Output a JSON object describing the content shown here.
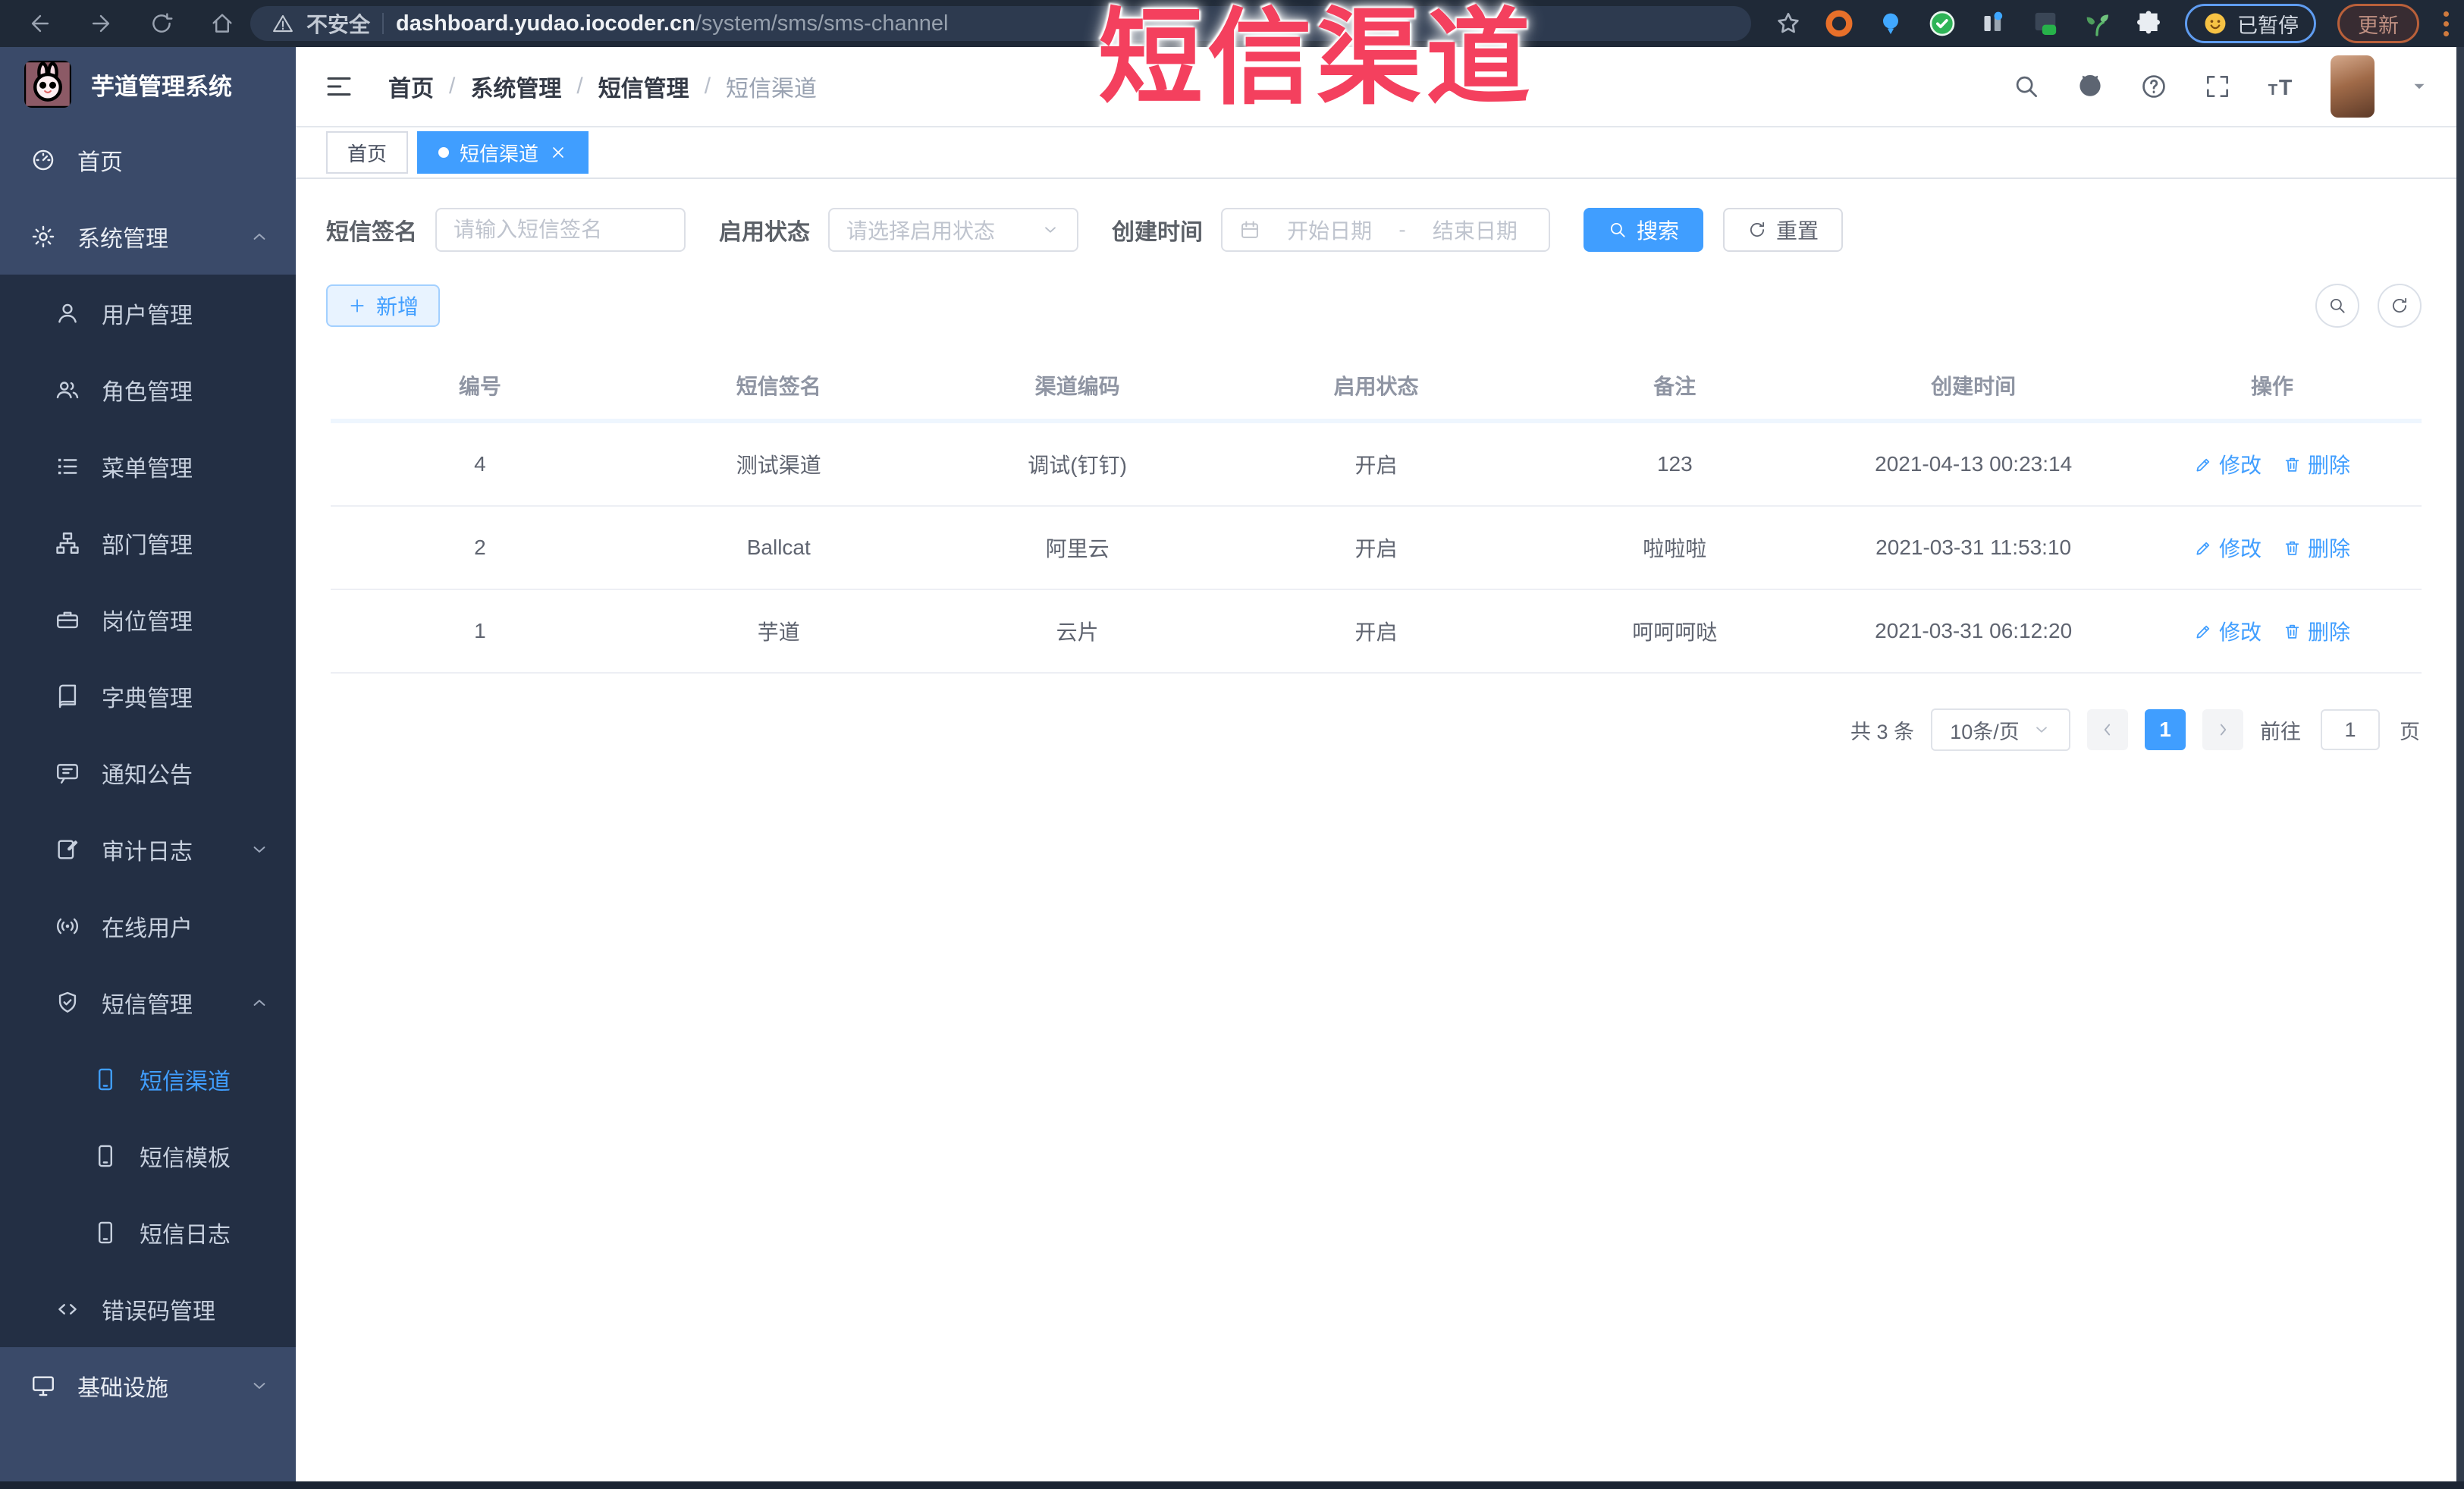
{
  "browser": {
    "security_label": "不安全",
    "url_domain": "dashboard.yudao.iocoder.cn",
    "url_path": "/system/sms/sms-channel",
    "paused_label": "已暂停",
    "update_label": "更新"
  },
  "overlay": {
    "title": "短信渠道",
    "color": "#f4405e"
  },
  "sidebar": {
    "logo_title": "芋道管理系统",
    "menu": [
      {
        "label": "首页",
        "icon": "dashboard",
        "level": 0,
        "variant": "top"
      },
      {
        "label": "系统管理",
        "icon": "gear",
        "level": 0,
        "variant": "top",
        "chevron": "up"
      },
      {
        "label": "用户管理",
        "icon": "user",
        "level": 1
      },
      {
        "label": "角色管理",
        "icon": "users",
        "level": 1
      },
      {
        "label": "菜单管理",
        "icon": "list",
        "level": 1
      },
      {
        "label": "部门管理",
        "icon": "tree",
        "level": 1
      },
      {
        "label": "岗位管理",
        "icon": "suitcase",
        "level": 1
      },
      {
        "label": "字典管理",
        "icon": "book",
        "level": 1
      },
      {
        "label": "通知公告",
        "icon": "message",
        "level": 1
      },
      {
        "label": "审计日志",
        "icon": "log",
        "level": 1,
        "chevron": "down"
      },
      {
        "label": "在线用户",
        "icon": "online",
        "level": 1
      },
      {
        "label": "短信管理",
        "icon": "sms",
        "level": 1,
        "chevron": "up"
      },
      {
        "label": "短信渠道",
        "icon": "phone",
        "level": 2,
        "active": true
      },
      {
        "label": "短信模板",
        "icon": "phone",
        "level": 2
      },
      {
        "label": "短信日志",
        "icon": "phone",
        "level": 2
      },
      {
        "label": "错误码管理",
        "icon": "code",
        "level": 1
      },
      {
        "label": "基础设施",
        "icon": "monitor",
        "level": 0,
        "variant": "top",
        "chevron": "down"
      }
    ]
  },
  "header": {
    "breadcrumbs": [
      {
        "label": "首页"
      },
      {
        "label": "系统管理"
      },
      {
        "label": "短信管理"
      },
      {
        "label": "短信渠道",
        "current": true
      }
    ]
  },
  "tabs": [
    {
      "label": "首页"
    },
    {
      "label": "短信渠道",
      "active": true
    }
  ],
  "filters": {
    "signature_label": "短信签名",
    "signature_placeholder": "请输入短信签名",
    "status_label": "启用状态",
    "status_placeholder": "请选择启用状态",
    "time_label": "创建时间",
    "start_placeholder": "开始日期",
    "range_separator": "-",
    "end_placeholder": "结束日期",
    "search_label": "搜索",
    "reset_label": "重置"
  },
  "toolbar": {
    "add_label": "新增"
  },
  "table": {
    "columns": [
      "编号",
      "短信签名",
      "渠道编码",
      "启用状态",
      "备注",
      "创建时间",
      "操作"
    ],
    "rows": [
      {
        "id": "4",
        "signature": "测试渠道",
        "code": "调试(钉钉)",
        "status": "开启",
        "remark": "123",
        "created": "2021-04-13 00:23:14"
      },
      {
        "id": "2",
        "signature": "Ballcat",
        "code": "阿里云",
        "status": "开启",
        "remark": "啦啦啦",
        "created": "2021-03-31 11:53:10"
      },
      {
        "id": "1",
        "signature": "芋道",
        "code": "云片",
        "status": "开启",
        "remark": "呵呵呵哒",
        "created": "2021-03-31 06:12:20"
      }
    ],
    "edit_label": "修改",
    "delete_label": "删除"
  },
  "pagination": {
    "total_text": "共 3 条",
    "page_size_text": "10条/页",
    "active_page": "1",
    "goto_label": "前往",
    "goto_value": "1",
    "goto_suffix": "页"
  },
  "colors": {
    "accent": "#409eff",
    "sidebar_dark": "#232f44",
    "sidebar_light": "#3a4a69"
  }
}
